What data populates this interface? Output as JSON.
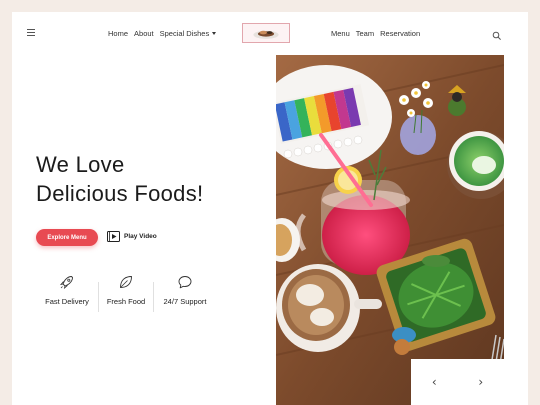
{
  "header": {
    "nav_left": [
      "Home",
      "About",
      "Special Dishes"
    ],
    "nav_right": [
      "Menu",
      "Team",
      "Reservation"
    ]
  },
  "hero": {
    "title_line1": "We Love",
    "title_line2": "Delicious Foods!",
    "explore_label": "Explore Menu",
    "play_label": "Play Video"
  },
  "features": [
    {
      "label": "Fast Delivery",
      "icon": "rocket-icon"
    },
    {
      "label": "Fresh Food",
      "icon": "leaf-icon"
    },
    {
      "label": "24/7 Support",
      "icon": "chat-bubble-icon"
    }
  ],
  "slider": {
    "prev": "‹",
    "next": "›"
  },
  "colors": {
    "accent": "#e84a52",
    "page_bg": "#f4ece6",
    "card_bg": "#ffffff"
  }
}
